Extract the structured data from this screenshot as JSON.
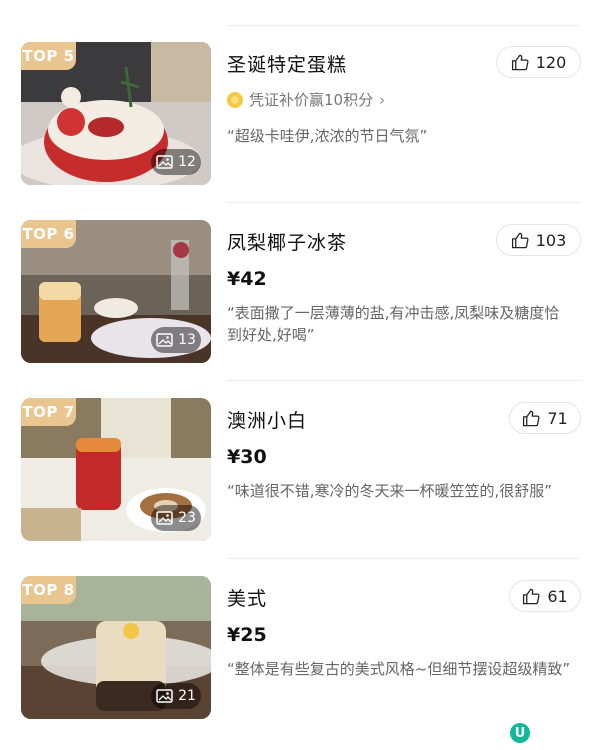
{
  "items": [
    {
      "rank": "TOP 5",
      "title": "圣诞特定蛋糕",
      "likes": "120",
      "promo": "凭证补价赢10积分",
      "quote": "“超级卡哇伊,浓浓的节日气氛”",
      "photos": "12"
    },
    {
      "rank": "TOP 6",
      "title": "凤梨椰子冰茶",
      "likes": "103",
      "price": "¥42",
      "quote": "“表面撒了一层薄薄的盐,有冲击感,凤梨味及糖度恰到好处,好喝”",
      "photos": "13"
    },
    {
      "rank": "TOP 7",
      "title": "澳洲小白",
      "likes": "71",
      "price": "¥30",
      "quote": "“味道很不错,寒冷的冬天来一杯暖笠笠的,很舒服”",
      "photos": "23"
    },
    {
      "rank": "TOP 8",
      "title": "美式",
      "likes": "61",
      "price": "¥25",
      "quote": "“整体是有些复古的美式风格~但细节摆设超级精致”",
      "photos": "21"
    }
  ],
  "colors": {
    "rank_badge": "#e9c690",
    "coin": "#f4c843",
    "logo": "#13b89a"
  },
  "icons": {
    "like": "thumbs-up-icon",
    "photo": "image-icon",
    "coin": "coin-icon",
    "chevron": "chevron-right-icon"
  },
  "watermark": "U"
}
